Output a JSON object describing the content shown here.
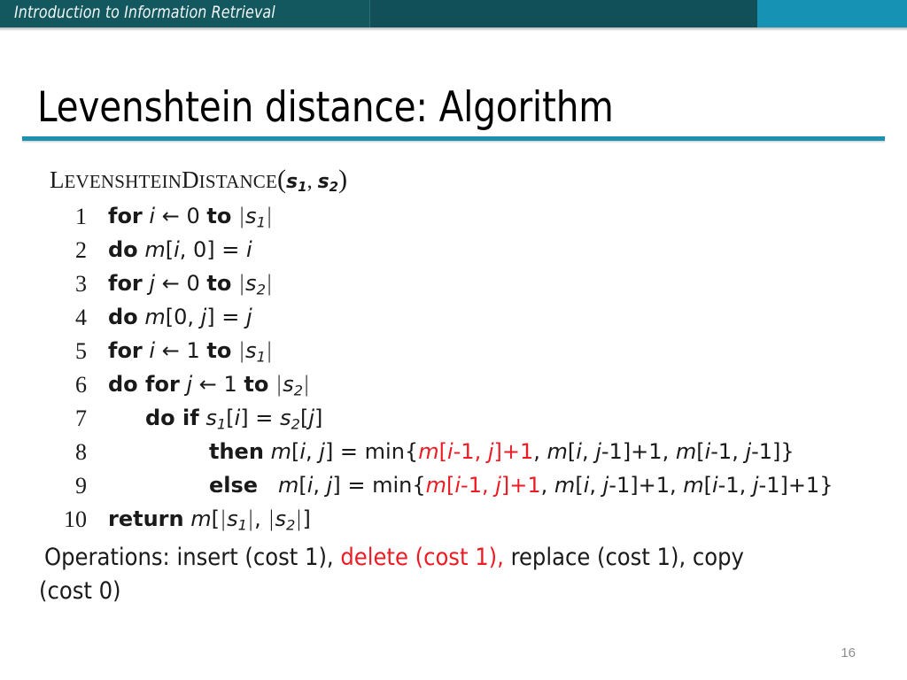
{
  "banner": {
    "course_title": "Introduction to Information Retrieval",
    "colors": {
      "dark_teal": "#14585f",
      "dark_teal_right": "#115058",
      "accent_teal": "#1592b4"
    }
  },
  "slide": {
    "title": "Levenshtein distance: Algorithm",
    "rule_color": "#1d92b0",
    "page_number": "16"
  },
  "algorithm": {
    "signature": {
      "name_part1": "L",
      "name_part1_rest": "EVENSHTEIN",
      "name_part2": "D",
      "name_part2_rest": "ISTANCE",
      "open_paren": "(",
      "arg1": "s",
      "arg1_sub": "1",
      "comma": ", ",
      "arg2": "s",
      "arg2_sub": "2",
      "close_paren": ")"
    },
    "lines": [
      {
        "number": "1",
        "indent": 122,
        "text": "for i ← 0 to |s1|"
      },
      {
        "number": "2",
        "indent": 122,
        "text": "do m[i, 0] = i"
      },
      {
        "number": "3",
        "indent": 122,
        "text": "for j ← 0 to |s2|"
      },
      {
        "number": "4",
        "indent": 122,
        "text": "do m[0, j] = j"
      },
      {
        "number": "5",
        "indent": 122,
        "text": "for i ← 1 to |s1|"
      },
      {
        "number": "6",
        "indent": 122,
        "text": "do for j ← 1 to |s2|"
      },
      {
        "number": "7",
        "indent": 164,
        "text": "do if s1[i] = s2[j]"
      },
      {
        "number": "8",
        "indent": 236,
        "text": "then m[i, j] = min{m[i-1, j]+1, m[i, j-1]+1, m[i-1, j-1]}"
      },
      {
        "number": "9",
        "indent": 236,
        "text": "else  m[i, j] = min{m[i-1, j]+1, m[i, j-1]+1, m[i-1, j-1]+1}"
      },
      {
        "number": "10",
        "indent": 122,
        "text": "return m[|s1|, |s2|]"
      }
    ],
    "highlight_color": "#ed1c24",
    "operations": {
      "label": "Operations:",
      "insert": "insert (cost 1),",
      "delete": "delete (cost 1),",
      "replace": "replace (cost 1),",
      "copy": "copy",
      "copy_cost": "(cost 0)"
    }
  }
}
